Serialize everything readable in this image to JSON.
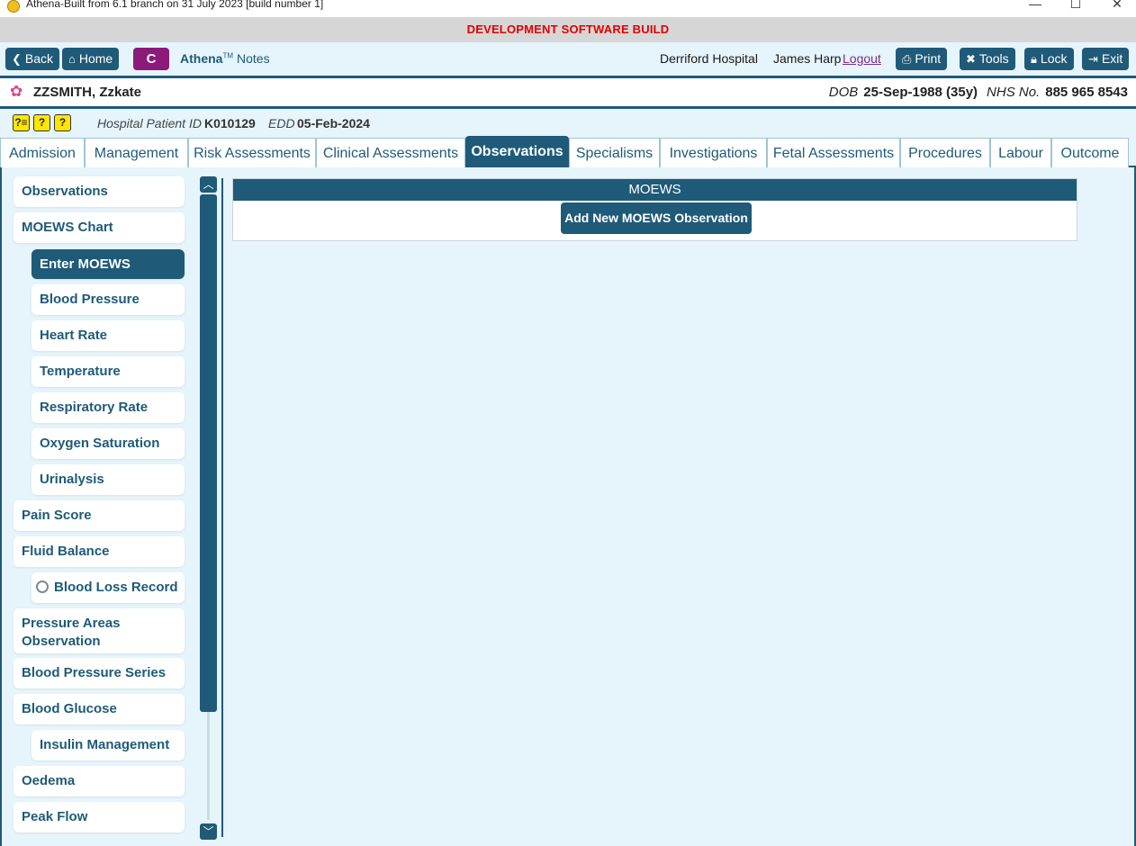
{
  "window": {
    "title": "Athena-Built from 6.1 branch on 31 July 2023 [build number 1]",
    "minimize": "—",
    "maximize": "☐",
    "close": "✕"
  },
  "banner": {
    "text": "DEVELOPMENT SOFTWARE BUILD",
    "color": "#e00000"
  },
  "toolbar": {
    "back": "Back",
    "home": "Home",
    "c": "C",
    "brand": "Athena",
    "tm": "TM",
    "notes": "Notes",
    "hospital": "Derriford Hospital",
    "user": "James Harp",
    "logout": "Logout",
    "print": "Print",
    "tools": "Tools",
    "lock": "Lock",
    "exit": "Exit"
  },
  "patient": {
    "name": "ZZSMITH, Zzkate",
    "dob_label": "DOB",
    "dob_value": "25-Sep-1988 (35y)",
    "nhs_label": "NHS No.",
    "nhs_value": "885 965 8543",
    "hospital_id_label": "Hospital Patient ID",
    "hospital_id_value": "K010129",
    "edd_label": "EDD",
    "edd_value": "05-Feb-2024",
    "alerts": [
      "?≡",
      "?",
      "?"
    ]
  },
  "tabs": [
    {
      "label": "Admission"
    },
    {
      "label": "Management"
    },
    {
      "label": "Risk Assessments"
    },
    {
      "label": "Clinical Assessments"
    },
    {
      "label": "Observations"
    },
    {
      "label": "Specialisms"
    },
    {
      "label": "Investigations"
    },
    {
      "label": "Fetal Assessments"
    },
    {
      "label": "Procedures"
    },
    {
      "label": "Labour"
    },
    {
      "label": "Outcome"
    }
  ],
  "sidebar": {
    "items": [
      {
        "label": "Observations"
      },
      {
        "label": "MOEWS Chart"
      },
      {
        "label": "Enter MOEWS"
      },
      {
        "label": "Blood Pressure"
      },
      {
        "label": "Heart Rate"
      },
      {
        "label": "Temperature"
      },
      {
        "label": "Respiratory Rate"
      },
      {
        "label": "Oxygen Saturation"
      },
      {
        "label": "Urinalysis"
      },
      {
        "label": "Pain Score"
      },
      {
        "label": "Fluid Balance"
      },
      {
        "label": "Blood Loss Record"
      },
      {
        "label": "Pressure Areas Observation"
      },
      {
        "label": "Blood Pressure Series"
      },
      {
        "label": "Blood Glucose"
      },
      {
        "label": "Insulin Management"
      },
      {
        "label": "Oedema"
      },
      {
        "label": "Peak Flow"
      }
    ]
  },
  "panel": {
    "title": "MOEWS",
    "add_button": "Add New MOEWS Observation"
  },
  "colors": {
    "primary": "#1f5a78",
    "background": "#e6f4fb",
    "c_button": "#8b1a7a",
    "alert": "#ffe600"
  }
}
